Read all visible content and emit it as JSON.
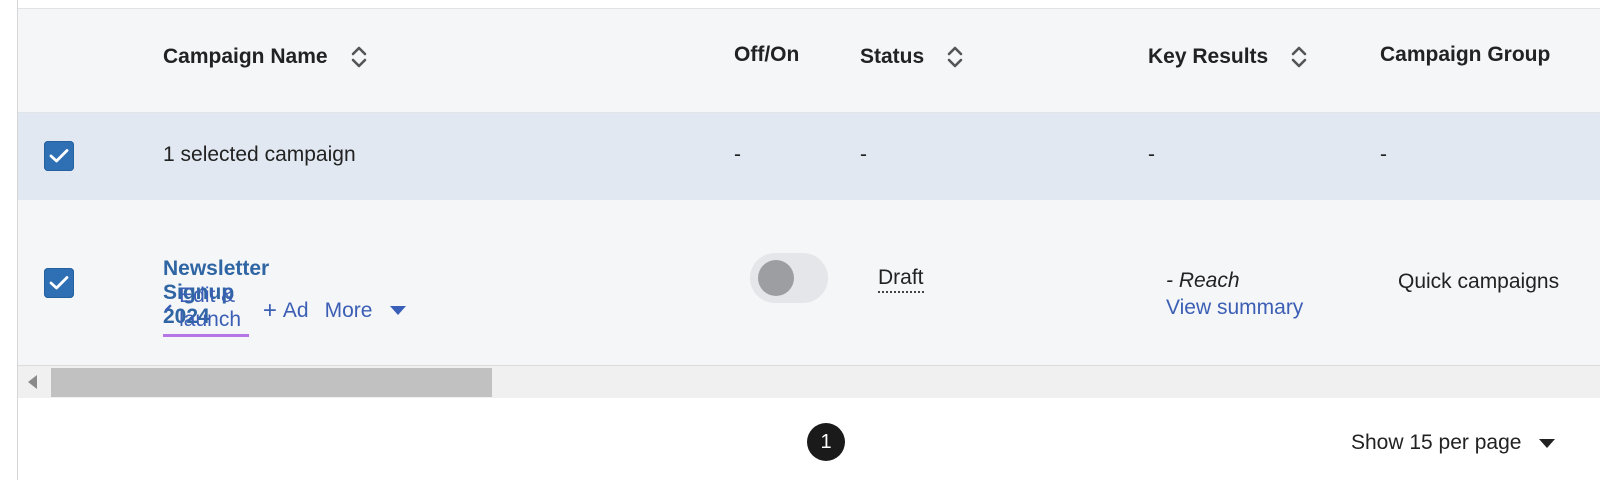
{
  "header": {
    "columns": [
      {
        "label": "Campaign Name",
        "sortable": true
      },
      {
        "label": "Off/On",
        "sortable": false
      },
      {
        "label": "Status",
        "sortable": true
      },
      {
        "label": "Key Results",
        "sortable": true
      },
      {
        "label": "Campaign Group",
        "sortable": false
      }
    ]
  },
  "selection_row": {
    "checked": true,
    "label": "1 selected campaign",
    "off_on": "-",
    "status": "-",
    "key_results": "-",
    "campaign_group": "-"
  },
  "campaign": {
    "checked": true,
    "name": "Newsletter Signup 2024",
    "actions": {
      "edit_label": "Edit & launch",
      "add_ad_label": "Ad",
      "more_label": "More"
    },
    "toggle_on": false,
    "status": "Draft",
    "key_results": "- Reach",
    "view_summary": "View summary",
    "campaign_group": "Quick campaigns"
  },
  "pagination": {
    "current_page": "1",
    "per_page_label": "Show 15 per page"
  },
  "colors": {
    "accent_link": "#3c5fb5",
    "checkbox": "#2f6fb4",
    "edit_underline": "#b776e6",
    "selected_row_bg": "#e1e8f1"
  }
}
